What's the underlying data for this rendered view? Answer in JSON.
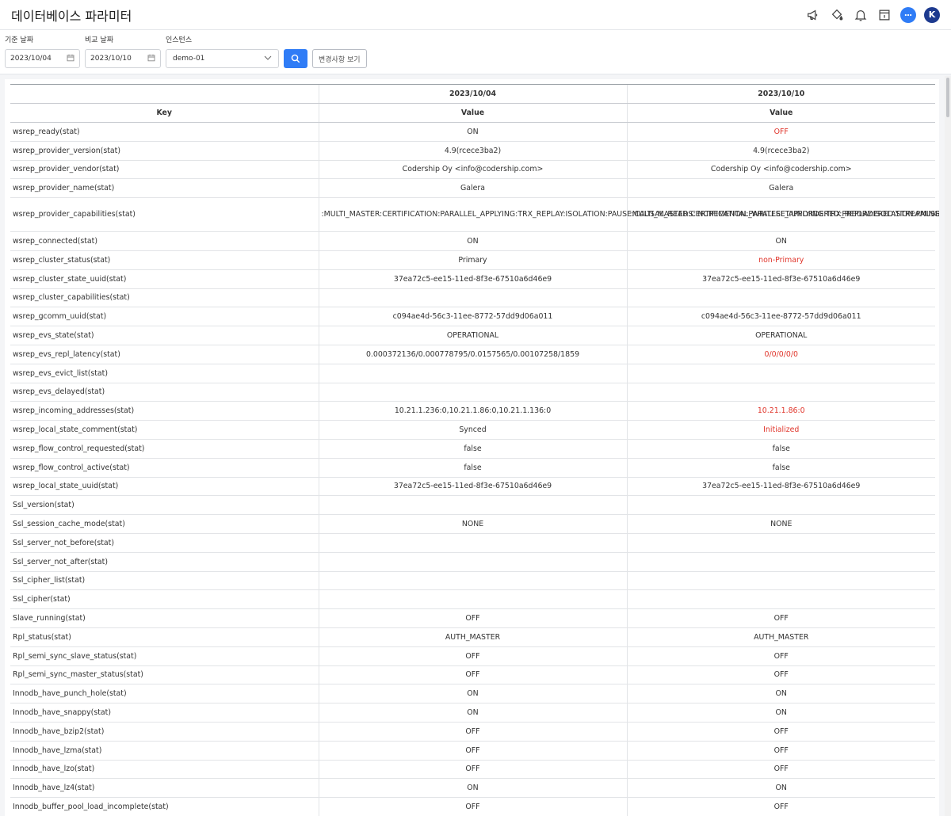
{
  "header": {
    "title": "데이터베이스 파라미터",
    "avatar_letter": "K"
  },
  "filters": {
    "base_date_label": "기준 날짜",
    "base_date_value": "2023/10/04",
    "compare_date_label": "비교 날짜",
    "compare_date_value": "2023/10/10",
    "instance_label": "인스턴스",
    "instance_value": "demo-01",
    "changes_button": "변경사항 보기"
  },
  "table": {
    "date1": "2023/10/04",
    "date2": "2023/10/10",
    "key_header": "Key",
    "value_header": "Value",
    "diff_color": "#e0352b",
    "rows": [
      {
        "key": "wsrep_ready(stat)",
        "v1": "ON",
        "v2": "OFF",
        "diff": true
      },
      {
        "key": "wsrep_provider_version(stat)",
        "v1": "4.9(rcece3ba2)",
        "v2": "4.9(rcece3ba2)",
        "diff": false
      },
      {
        "key": "wsrep_provider_vendor(stat)",
        "v1": "Codership Oy <info@codership.com>",
        "v2": "Codership Oy <info@codership.com>",
        "diff": false
      },
      {
        "key": "wsrep_provider_name(stat)",
        "v1": "Galera",
        "v2": "Galera",
        "diff": false
      },
      {
        "key": "wsrep_provider_capabilities(stat)",
        "v1": ":MULTI_MASTER:CERTIFICATION:PARALLEL_APPLYING:TRX_REPLAY:ISOLATION:PAUSE:CAUSAL_READS:INCREMENTAL_WRITESET:UNORDERED:PREORDERED:STREAMING:NBO:",
        "v2": ":MULTI_MASTER:CERTIFICATION:PARALLEL_APPLYING:TRX_REPLAY:ISOLATION:PAUSE:CAUSAL_READS:INCREMENTAL_WRITESET:UNORDERED:PREORDERED:STREAMING:NBO:",
        "diff": false,
        "tall": true
      },
      {
        "key": "wsrep_connected(stat)",
        "v1": "ON",
        "v2": "ON",
        "diff": false
      },
      {
        "key": "wsrep_cluster_status(stat)",
        "v1": "Primary",
        "v2": "non-Primary",
        "diff": true
      },
      {
        "key": "wsrep_cluster_state_uuid(stat)",
        "v1": "37ea72c5-ee15-11ed-8f3e-67510a6d46e9",
        "v2": "37ea72c5-ee15-11ed-8f3e-67510a6d46e9",
        "diff": false
      },
      {
        "key": "wsrep_cluster_capabilities(stat)",
        "v1": "",
        "v2": "",
        "diff": false
      },
      {
        "key": "wsrep_gcomm_uuid(stat)",
        "v1": "c094ae4d-56c3-11ee-8772-57dd9d06a011",
        "v2": "c094ae4d-56c3-11ee-8772-57dd9d06a011",
        "diff": false
      },
      {
        "key": "wsrep_evs_state(stat)",
        "v1": "OPERATIONAL",
        "v2": "OPERATIONAL",
        "diff": false
      },
      {
        "key": "wsrep_evs_repl_latency(stat)",
        "v1": "0.000372136/0.000778795/0.0157565/0.00107258/1859",
        "v2": "0/0/0/0/0",
        "diff": true
      },
      {
        "key": "wsrep_evs_evict_list(stat)",
        "v1": "",
        "v2": "",
        "diff": false
      },
      {
        "key": "wsrep_evs_delayed(stat)",
        "v1": "",
        "v2": "",
        "diff": false
      },
      {
        "key": "wsrep_incoming_addresses(stat)",
        "v1": "10.21.1.236:0,10.21.1.86:0,10.21.1.136:0",
        "v2": "10.21.1.86:0",
        "diff": true
      },
      {
        "key": "wsrep_local_state_comment(stat)",
        "v1": "Synced",
        "v2": "Initialized",
        "diff": true
      },
      {
        "key": "wsrep_flow_control_requested(stat)",
        "v1": "false",
        "v2": "false",
        "diff": false
      },
      {
        "key": "wsrep_flow_control_active(stat)",
        "v1": "false",
        "v2": "false",
        "diff": false
      },
      {
        "key": "wsrep_local_state_uuid(stat)",
        "v1": "37ea72c5-ee15-11ed-8f3e-67510a6d46e9",
        "v2": "37ea72c5-ee15-11ed-8f3e-67510a6d46e9",
        "diff": false
      },
      {
        "key": "Ssl_version(stat)",
        "v1": "",
        "v2": "",
        "diff": false
      },
      {
        "key": "Ssl_session_cache_mode(stat)",
        "v1": "NONE",
        "v2": "NONE",
        "diff": false
      },
      {
        "key": "Ssl_server_not_before(stat)",
        "v1": "",
        "v2": "",
        "diff": false
      },
      {
        "key": "Ssl_server_not_after(stat)",
        "v1": "",
        "v2": "",
        "diff": false
      },
      {
        "key": "Ssl_cipher_list(stat)",
        "v1": "",
        "v2": "",
        "diff": false
      },
      {
        "key": "Ssl_cipher(stat)",
        "v1": "",
        "v2": "",
        "diff": false
      },
      {
        "key": "Slave_running(stat)",
        "v1": "OFF",
        "v2": "OFF",
        "diff": false
      },
      {
        "key": "Rpl_status(stat)",
        "v1": "AUTH_MASTER",
        "v2": "AUTH_MASTER",
        "diff": false
      },
      {
        "key": "Rpl_semi_sync_slave_status(stat)",
        "v1": "OFF",
        "v2": "OFF",
        "diff": false
      },
      {
        "key": "Rpl_semi_sync_master_status(stat)",
        "v1": "OFF",
        "v2": "OFF",
        "diff": false
      },
      {
        "key": "Innodb_have_punch_hole(stat)",
        "v1": "ON",
        "v2": "ON",
        "diff": false
      },
      {
        "key": "Innodb_have_snappy(stat)",
        "v1": "ON",
        "v2": "ON",
        "diff": false
      },
      {
        "key": "Innodb_have_bzip2(stat)",
        "v1": "OFF",
        "v2": "OFF",
        "diff": false
      },
      {
        "key": "Innodb_have_lzma(stat)",
        "v1": "OFF",
        "v2": "OFF",
        "diff": false
      },
      {
        "key": "Innodb_have_lzo(stat)",
        "v1": "OFF",
        "v2": "OFF",
        "diff": false
      },
      {
        "key": "Innodb_have_lz4(stat)",
        "v1": "ON",
        "v2": "ON",
        "diff": false
      },
      {
        "key": "Innodb_buffer_pool_load_incomplete(stat)",
        "v1": "OFF",
        "v2": "OFF",
        "diff": false
      }
    ]
  }
}
